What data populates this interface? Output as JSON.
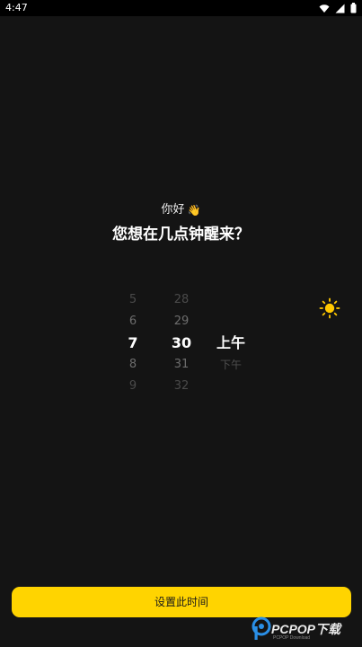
{
  "status_bar": {
    "time": "4:47",
    "icons": [
      "wifi-icon",
      "signal-icon",
      "battery-icon"
    ]
  },
  "greeting": {
    "text": "你好",
    "emoji": "👋"
  },
  "question": "您想在几点钟醒来？",
  "picker": {
    "hours": [
      "5",
      "6",
      "7",
      "8",
      "9"
    ],
    "minutes": [
      "28",
      "29",
      "30",
      "31",
      "32"
    ],
    "meridiem": [
      "上午",
      "下午"
    ],
    "selected": {
      "hour": "7",
      "minute": "30",
      "meridiem": "上午"
    }
  },
  "theme_icon": "sun-icon",
  "button": {
    "label": "设置此时间"
  },
  "watermark": {
    "text": "PCPOP下载",
    "sub": "PCPOP Download"
  },
  "colors": {
    "background": "#141414",
    "accent": "#ffd400",
    "sun": "#ffc800"
  }
}
